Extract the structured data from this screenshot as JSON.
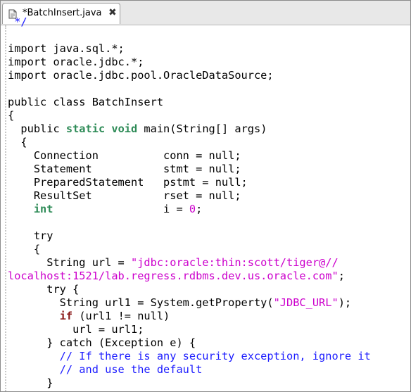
{
  "tab": {
    "label": "*BatchInsert.java",
    "close_glyph": "✖",
    "icon": "java-file-icon"
  },
  "code": {
    "lines": [
      [
        {
          "t": " */",
          "c": "com"
        }
      ],
      [],
      [
        {
          "t": "import java.sql.*;"
        }
      ],
      [
        {
          "t": "import oracle.jdbc.*;"
        }
      ],
      [
        {
          "t": "import oracle.jdbc.pool.OracleDataSource;"
        }
      ],
      [],
      [
        {
          "t": "public class BatchInsert"
        }
      ],
      [
        {
          "t": "{"
        }
      ],
      [
        {
          "t": "  public "
        },
        {
          "t": "static",
          "c": "kw-static"
        },
        {
          "t": " "
        },
        {
          "t": "void",
          "c": "kw-static"
        },
        {
          "t": " main(String[] args)"
        }
      ],
      [
        {
          "t": "  {"
        }
      ],
      [
        {
          "t": "    Connection          conn = null;"
        }
      ],
      [
        {
          "t": "    Statement           stmt = null;"
        }
      ],
      [
        {
          "t": "    PreparedStatement   pstmt = null;"
        }
      ],
      [
        {
          "t": "    ResultSet           rset = null;"
        }
      ],
      [
        {
          "t": "    "
        },
        {
          "t": "int",
          "c": "kw-static"
        },
        {
          "t": "                 i = "
        },
        {
          "t": "0",
          "c": "num"
        },
        {
          "t": ";"
        }
      ],
      [],
      [
        {
          "t": "    try"
        }
      ],
      [
        {
          "t": "    {"
        }
      ],
      [
        {
          "t": "      String url = "
        },
        {
          "t": "\"jdbc:oracle:thin:scott/tiger@//",
          "c": "str"
        }
      ],
      [
        {
          "t": "localhost:1521/lab.regress.rdbms.dev.us.oracle.com\"",
          "c": "str"
        },
        {
          "t": ";"
        }
      ],
      [
        {
          "t": "      try {"
        }
      ],
      [
        {
          "t": "        String url1 = System.getProperty("
        },
        {
          "t": "\"JDBC_URL\"",
          "c": "str"
        },
        {
          "t": ");"
        }
      ],
      [
        {
          "t": "        "
        },
        {
          "t": "if",
          "c": "kw-ctrl"
        },
        {
          "t": " (url1 != null)"
        }
      ],
      [
        {
          "t": "          url = url1;"
        }
      ],
      [
        {
          "t": "      } catch (Exception e) {"
        }
      ],
      [
        {
          "t": "        // If there is any security exception, ignore it",
          "c": "com"
        }
      ],
      [
        {
          "t": "        // and use the default",
          "c": "com"
        }
      ],
      [
        {
          "t": "      }"
        }
      ]
    ]
  }
}
